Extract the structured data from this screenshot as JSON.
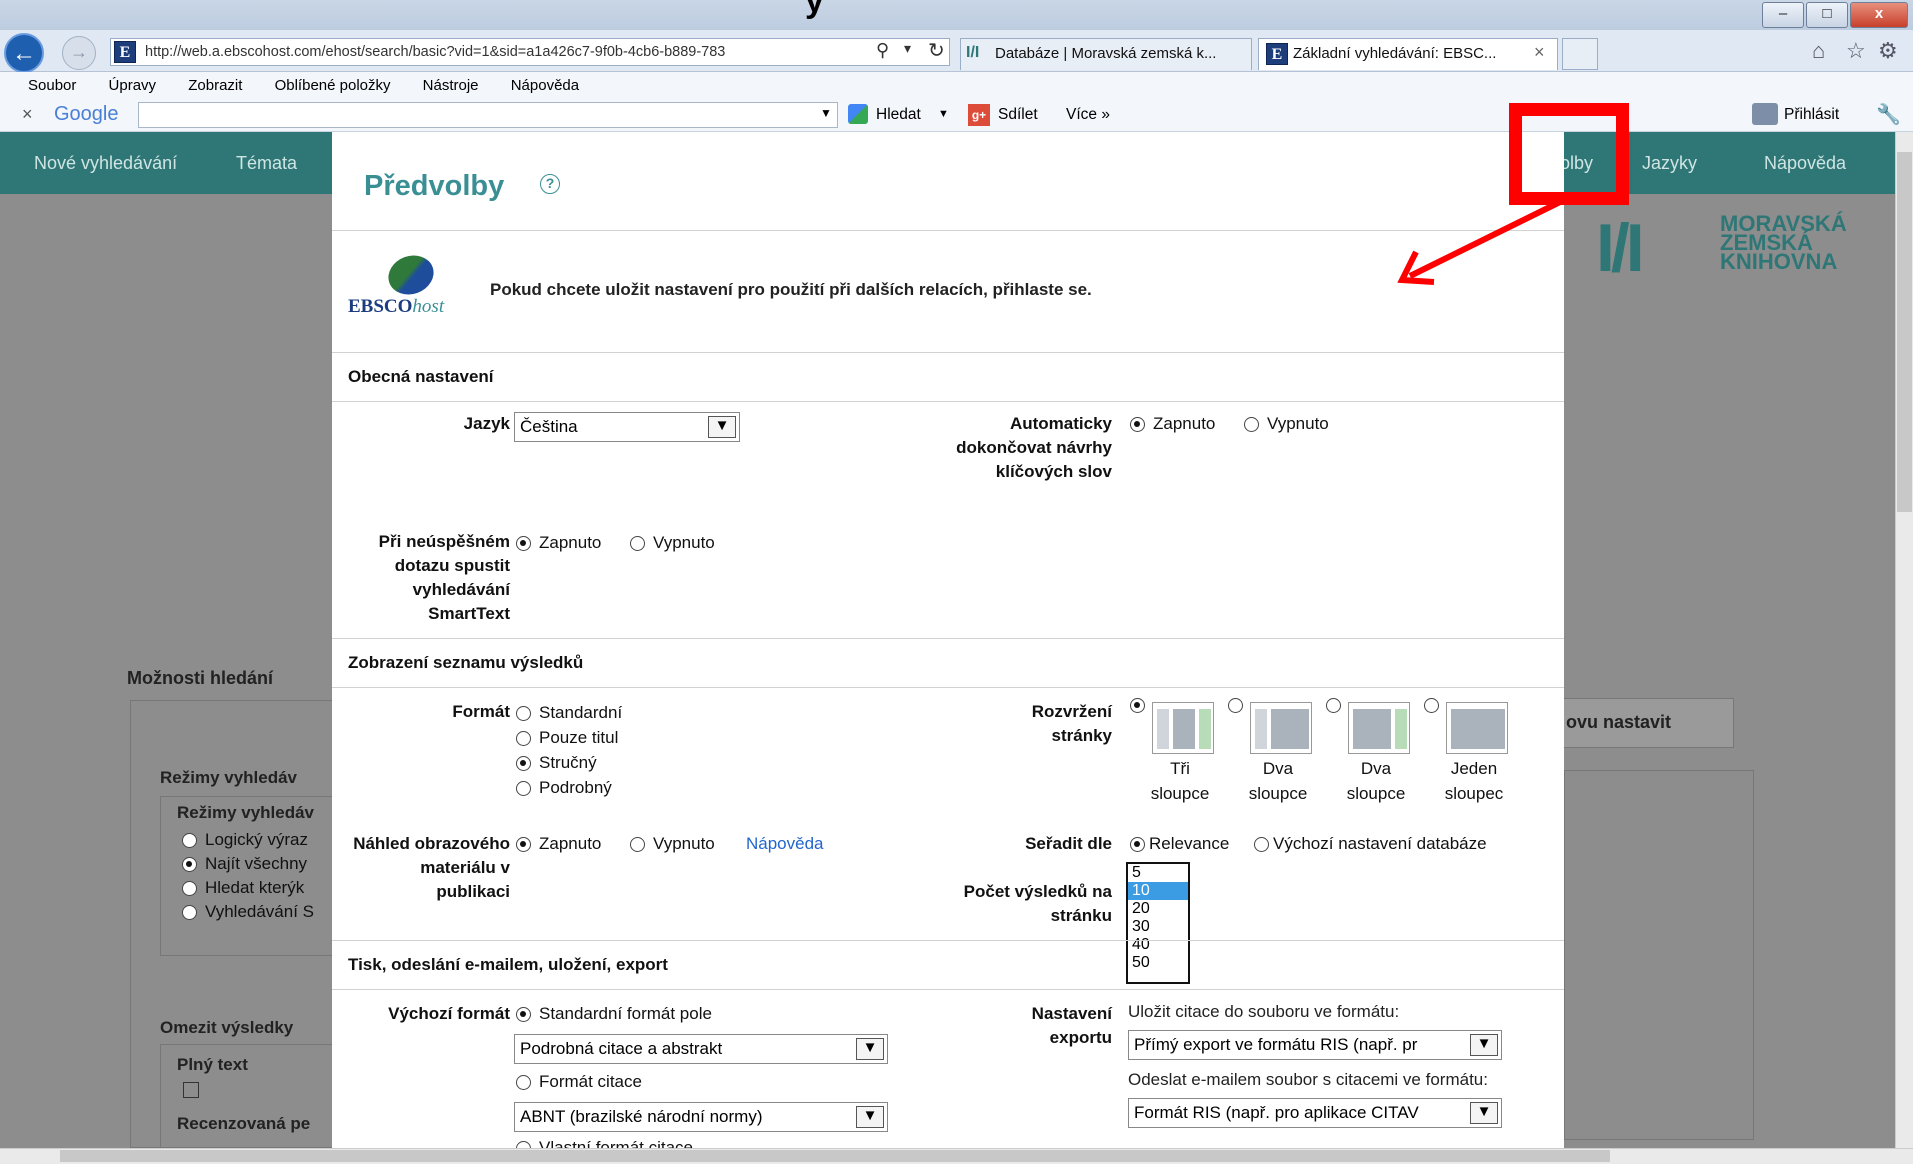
{
  "browser": {
    "address": "http://web.a.ebscohost.com/ehost/search/basic?vid=1&sid=a1a426c7-9f0b-4cb6-b889-783",
    "tabs": [
      {
        "label": "Databáze | Moravská zemská k..."
      },
      {
        "label": "Základní vyhledávání: EBSC...",
        "close": "×"
      }
    ],
    "menu": [
      "Soubor",
      "Úpravy",
      "Zobrazit",
      "Oblíbené položky",
      "Nástroje",
      "Nápověda"
    ],
    "google_toolbar": {
      "close": "×",
      "logo": "Google",
      "search": "Hledat",
      "share": "Sdílet",
      "more": "Více »",
      "login": "Přihlásit"
    },
    "window_controls": {
      "minimize": "–",
      "maximize": "□",
      "close": "x"
    }
  },
  "site": {
    "nav": {
      "new_search": "Nové vyhledávání",
      "topics": "Témata",
      "prefs_fragment": "olby",
      "languages": "Jazyky",
      "help": "Nápověda"
    },
    "logo": {
      "mark": "I/I",
      "line1": "MORAVSKÁ",
      "line2": "ZEMSKÁ",
      "line3": "KNIHOVNA"
    },
    "background": {
      "search_options": "Možnosti hledání",
      "modes_heading": "Režimy vyhledáv",
      "modes_sub": "Režimy vyhledáv",
      "modes": [
        {
          "label": "Logický výraz",
          "selected": false
        },
        {
          "label": "Najít všechny",
          "selected": true
        },
        {
          "label": "Hledat kterýk",
          "selected": false
        },
        {
          "label": "Vyhledávání S",
          "selected": false
        }
      ],
      "limit_results": "Omezit výsledky",
      "full_text": "Plný text",
      "peer_reviewed": "Recenzovaná pe",
      "reset_fragment": "ovu nastavit"
    }
  },
  "modal": {
    "title": "Předvolby",
    "help_icon": "?",
    "ebsco_logo_main": "EBSCO",
    "ebsco_logo_italic": "host",
    "login_note": "Pokud chcete uložit nastavení pro použití při dalších relacích, přihlaste se.",
    "general": {
      "heading": "Obecná nastavení",
      "language_label": "Jazyk",
      "language_value": "Čeština",
      "autocomplete_label": "Automaticky dokončovat návrhy klíčových slov",
      "autocomplete_on": "Zapnuto",
      "autocomplete_off": "Vypnuto",
      "smarttext_label": "Při neúspěšném dotazu spustit vyhledávání SmartText",
      "smarttext_on": "Zapnuto",
      "smarttext_off": "Vypnuto"
    },
    "results": {
      "heading": "Zobrazení seznamu výsledků",
      "format_label": "Formát",
      "formats": [
        {
          "label": "Standardní",
          "selected": false
        },
        {
          "label": "Pouze titul",
          "selected": false
        },
        {
          "label": "Stručný",
          "selected": true
        },
        {
          "label": "Podrobný",
          "selected": false
        }
      ],
      "layout_label": "Rozvržení stránky",
      "layouts": [
        {
          "line1": "Tři",
          "line2": "sloupce",
          "selected": true
        },
        {
          "line1": "Dva",
          "line2": "sloupce",
          "selected": false
        },
        {
          "line1": "Dva",
          "line2": "sloupce",
          "selected": false
        },
        {
          "line1": "Jeden",
          "line2": "sloupec",
          "selected": false
        }
      ],
      "preview_label": "Náhled obrazového materiálu v publikaci",
      "preview_on": "Zapnuto",
      "preview_off": "Vypnuto",
      "preview_help": "Nápověda",
      "sort_label": "Seřadit dle",
      "sort_relevance": "Relevance",
      "sort_default": "Výchozí nastavení databáze",
      "per_page_label": "Počet výsledků na stránku",
      "per_page_options": [
        "5",
        "10",
        "20",
        "30",
        "40",
        "50"
      ],
      "per_page_selected": "10"
    },
    "print": {
      "heading": "Tisk, odeslání e-mailem, uložení, export",
      "default_format_label": "Výchozí formát",
      "standard_field": "Standardní formát pole",
      "standard_select": "Podrobná citace a abstrakt",
      "citation_format": "Formát citace",
      "citation_select": "ABNT (brazilské národní normy)",
      "custom_citation": "Vlastní formát citace",
      "export_label": "Nastavení exportu",
      "save_note": "Uložit citace do souboru ve formátu:",
      "save_select": "Přímý export ve formátu RIS (např. pr",
      "email_note": "Odeslat e-mailem soubor s citacemi ve formátu:",
      "email_select": "Formát RIS (např. pro aplikace CITAV"
    }
  },
  "annotation_colors": {
    "highlight": "#ff0000"
  },
  "top_partial_title": "y"
}
